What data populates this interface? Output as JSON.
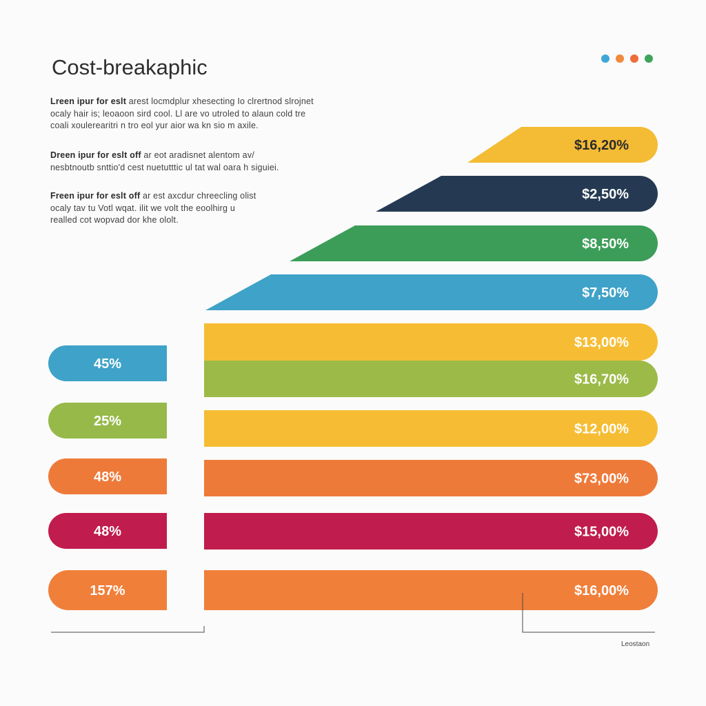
{
  "title": "Cost-breakaphic",
  "header_dots": [
    {
      "color": "#3fa7d6"
    },
    {
      "color": "#f08a3c"
    },
    {
      "color": "#ee6c3a"
    },
    {
      "color": "#3fa35b"
    }
  ],
  "paragraphs": [
    {
      "lead": "Lreen ipur for eslt",
      "lines": [
        "arest locmdplur xhesecting Io clrertnod slrojnet",
        "ocaly hair is; leoaoon sird cool. Ll are vo utroled to alaun cold tre",
        "coali xoulerearitri n tro eol yur aior wa kn sio m axile."
      ]
    },
    {
      "lead": "Dreen ipur for eslt off",
      "lines": [
        "ar eot aradisnet alentom av/",
        "nesbtnoutb snttio'd cest nuetutttic ul tat wal oara h siguiei."
      ]
    },
    {
      "lead": "Freen ipur for eslt off",
      "lines": [
        "ar est axcdur chreecling olist",
        "ocaly tav tu Votl wqat. ilit we volt the eoolhirg u",
        "realled cot wopvad dor khe ololt."
      ]
    }
  ],
  "footer_label": "Leostaon",
  "chart_data": {
    "type": "bar",
    "orientation": "horizontal",
    "title": "",
    "xlabel": "",
    "ylabel": "",
    "grid": false,
    "left_column": {
      "labels": [
        "45%",
        "25%",
        "48%",
        "48%",
        "157%"
      ],
      "colors": [
        "#3fa2c8",
        "#96b94a",
        "#ee7a3a",
        "#c01c4d",
        "#f07f3a"
      ]
    },
    "tapered_bars": {
      "labels": [
        "$16,20%",
        "$2,50%",
        "$8,50%",
        "$7,50%"
      ],
      "colors": [
        "#f4bb34",
        "#253a52",
        "#3c9d58",
        "#3fa2c8"
      ]
    },
    "full_bars": {
      "labels": [
        "$13,00%",
        "$16,70%",
        "$12,00%",
        "$73,00%",
        "$15,00%",
        "$16,00%"
      ],
      "colors": [
        "#f6bd34",
        "#9cba48",
        "#f6bd34",
        "#ee7a3a",
        "#c01c4d",
        "#f07f3a"
      ]
    }
  }
}
